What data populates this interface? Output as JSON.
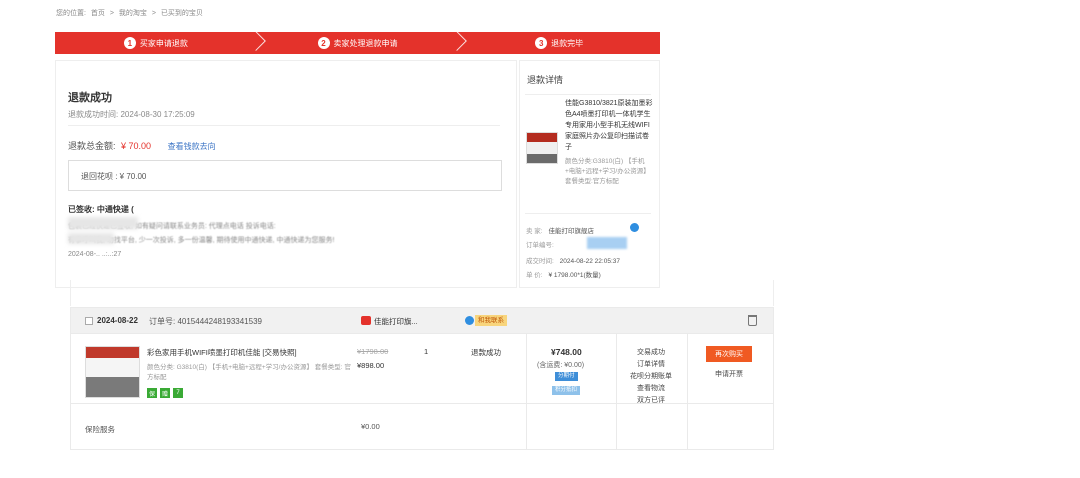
{
  "breadcrumb": [
    "您的位置:",
    "首页",
    ">",
    "我的淘宝",
    ">",
    "已买到的宝贝"
  ],
  "steps": [
    {
      "num": "1",
      "label": "买家申请退款"
    },
    {
      "num": "2",
      "label": "卖家处理退款申请"
    },
    {
      "num": "3",
      "label": "退款完毕"
    }
  ],
  "refund": {
    "title": "退款成功",
    "time_label": "退款成功时间:",
    "time": "2024-08-30 17:25:09",
    "total_label": "退款总金额:",
    "total_amount": "¥ 70.00",
    "trace_link": "查看钱款去向",
    "huabei": "退回花呗 : ¥ 70.00",
    "signed_label": "已签收: 中通快递",
    "signed_extra": "(",
    "blur_line1": "包裹已经快递已签收, 如有疑问请联系业务员: 代理点电话 投诉电话:",
    "blur_line2": "有事呼叫我, 勿找平台, 少一次投诉, 多一份温馨, 期待使用中通快递, 中通快递为您服务!",
    "signed_time": "2024-08-..  ..:..:27"
  },
  "refund_detail": {
    "title": "退款详情",
    "product_name": "佳能G3810/3821原装加墨彩色A4喷墨打印机一体机学生专用家用小型手机无线WIFI家庭照片办公复印扫描试卷子",
    "sku": "颜色分类:G3810(白) 【手机+电脑+远程+学习/办公资源】 套餐类型:官方标配",
    "seller_label": "卖     家:",
    "seller": "佳能打印旗舰店",
    "order_no_label": "订单编号:",
    "deal_time_label": "成交时间:",
    "deal_time": "2024-08-22 22:05:37",
    "unit_price_label": "单     价:",
    "unit_price": "¥ 1798.00*1(数量)"
  },
  "order": {
    "date": "2024-08-22",
    "order_no": "订单号: 4015444248193341539",
    "shop": "佳能打印旗...",
    "chat_label": "和我联系",
    "product_name": "彩色家用手机WIFI喷墨打印机佳能 [交易快照]",
    "product_sku": "颜色分类: G3810(白) 【手机+电脑+远程+学习/办公资源】 套餐类型: 官方标配",
    "badges": [
      "保",
      "赠",
      "7"
    ],
    "price_old": "¥1798.00",
    "price_new": "¥898.00",
    "qty": "1",
    "status": "退款成功",
    "pay_total": "¥748.00",
    "shipping": "(含运费: ¥0.00)",
    "tag1": "分期付",
    "tag2": "积分抵扣",
    "links": [
      "交易成功",
      "订单详情",
      "花呗分期账单",
      "查看物流",
      "双方已评"
    ],
    "rebuy": "再次购买",
    "invoice": "申请开票",
    "insurance_label": "保险服务",
    "insurance_value": "¥0.00"
  },
  "colors": {
    "accent": "#e4322b",
    "link": "#3b74c5",
    "rebuy": "#f05a22"
  }
}
